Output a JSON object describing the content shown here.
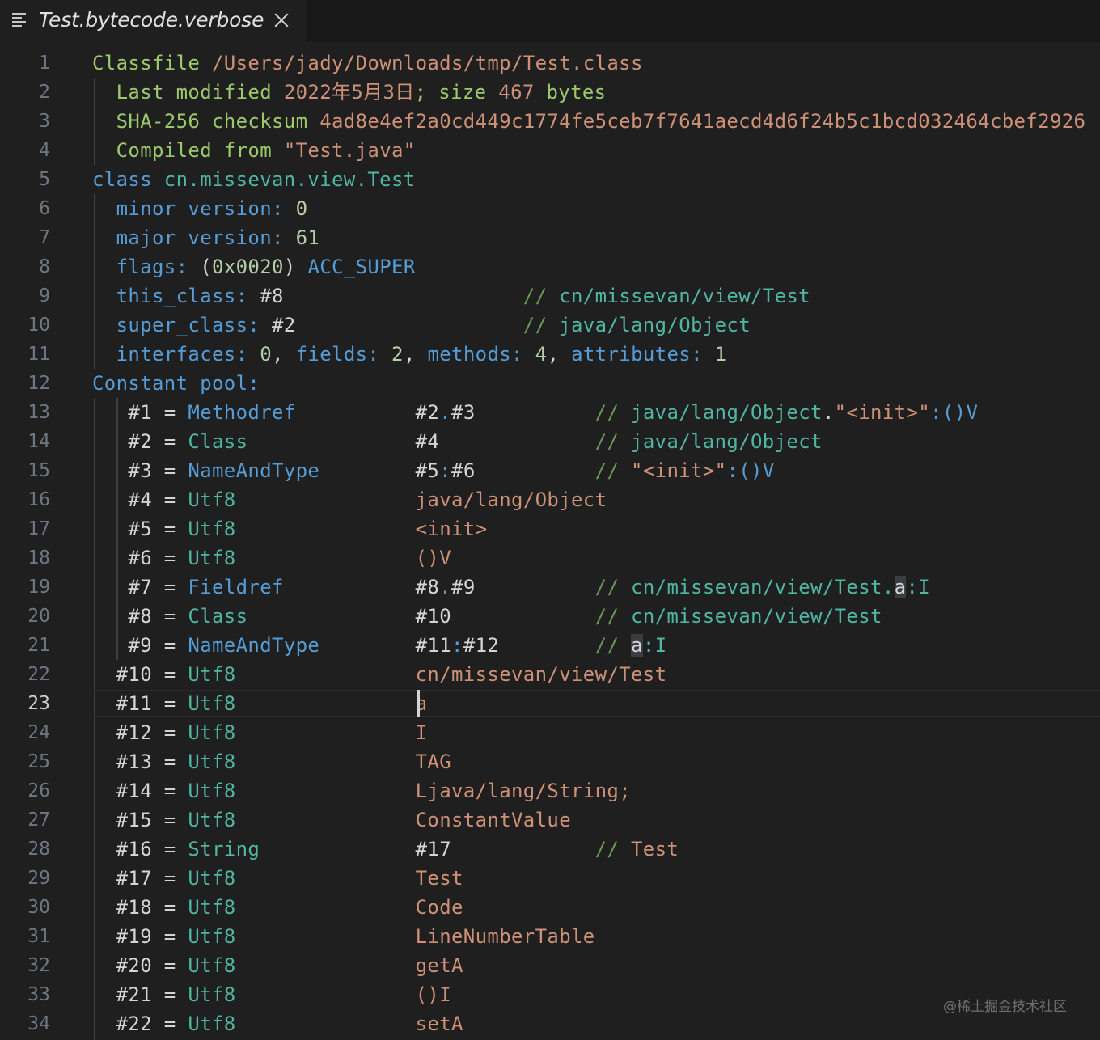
{
  "tab": {
    "title": "Test.bytecode.verbose",
    "close_icon": "close-icon",
    "file_icon": "text-lines-icon"
  },
  "colors": {
    "background": "#1f1f1f",
    "keyword": "#4fb6a2",
    "name": "#569cd6",
    "string": "#ce9178",
    "comment": "#6a9955",
    "number": "#b5cea8"
  },
  "editor": {
    "current_line": 23,
    "lines": [
      {
        "num": "1",
        "tokens": [
          [
            "t-head",
            "Classfile "
          ],
          [
            "t-path",
            "/Users/jady/Downloads/tmp/Test.class"
          ]
        ]
      },
      {
        "num": "2",
        "tokens": [
          [
            "t-plain",
            "  "
          ],
          [
            "t-head",
            "Last modified "
          ],
          [
            "t-str",
            "2022年5月3日"
          ],
          [
            "t-head",
            "; size "
          ],
          [
            "t-str",
            "467"
          ],
          [
            "t-head",
            " bytes"
          ]
        ]
      },
      {
        "num": "3",
        "tokens": [
          [
            "t-plain",
            "  "
          ],
          [
            "t-head",
            "SHA-256 checksum "
          ],
          [
            "t-str",
            "4ad8e4ef2a0cd449c1774fe5ceb7f7641aecd4d6f24b5c1bcd032464cbef2926"
          ]
        ]
      },
      {
        "num": "4",
        "tokens": [
          [
            "t-plain",
            "  "
          ],
          [
            "t-head",
            "Compiled from "
          ],
          [
            "t-str",
            "\"Test.java\""
          ]
        ]
      },
      {
        "num": "5",
        "tokens": [
          [
            "t-key",
            "class "
          ],
          [
            "t-kw",
            "cn.missevan.view.Test"
          ]
        ]
      },
      {
        "num": "6",
        "tokens": [
          [
            "t-plain",
            "  "
          ],
          [
            "t-key",
            "minor version: "
          ],
          [
            "t-num",
            "0"
          ]
        ]
      },
      {
        "num": "7",
        "tokens": [
          [
            "t-plain",
            "  "
          ],
          [
            "t-key",
            "major version: "
          ],
          [
            "t-num",
            "61"
          ]
        ]
      },
      {
        "num": "8",
        "tokens": [
          [
            "t-plain",
            "  "
          ],
          [
            "t-key",
            "flags: "
          ],
          [
            "t-plain",
            "("
          ],
          [
            "t-num",
            "0x0020"
          ],
          [
            "t-plain",
            ") "
          ],
          [
            "t-key",
            "ACC_SUPER"
          ]
        ]
      },
      {
        "num": "9",
        "tokens": [
          [
            "t-plain",
            "  "
          ],
          [
            "t-key",
            "this_class: "
          ],
          [
            "t-plain",
            "#8"
          ],
          [
            "t-plain",
            "                    "
          ],
          [
            "t-cmt",
            "// "
          ],
          [
            "t-kw",
            "cn/missevan/view/Test"
          ]
        ]
      },
      {
        "num": "10",
        "tokens": [
          [
            "t-plain",
            "  "
          ],
          [
            "t-key",
            "super_class: "
          ],
          [
            "t-plain",
            "#2"
          ],
          [
            "t-plain",
            "                   "
          ],
          [
            "t-cmt",
            "// "
          ],
          [
            "t-kw",
            "java/lang/Object"
          ]
        ]
      },
      {
        "num": "11",
        "tokens": [
          [
            "t-plain",
            "  "
          ],
          [
            "t-key",
            "interfaces: "
          ],
          [
            "t-num",
            "0"
          ],
          [
            "t-plain",
            ", "
          ],
          [
            "t-key",
            "fields: "
          ],
          [
            "t-num",
            "2"
          ],
          [
            "t-plain",
            ", "
          ],
          [
            "t-key",
            "methods: "
          ],
          [
            "t-num",
            "4"
          ],
          [
            "t-plain",
            ", "
          ],
          [
            "t-key",
            "attributes: "
          ],
          [
            "t-num",
            "1"
          ]
        ]
      },
      {
        "num": "12",
        "tokens": [
          [
            "t-key",
            "Constant pool:"
          ]
        ]
      },
      {
        "num": "13",
        "tokens": [
          [
            "t-plain",
            "   #1 = "
          ],
          [
            "t-key",
            "Methodref"
          ],
          [
            "t-plain",
            "          "
          ],
          [
            "t-plain",
            "#2"
          ],
          [
            "t-key",
            "."
          ],
          [
            "t-plain",
            "#3"
          ],
          [
            "t-plain",
            "          "
          ],
          [
            "t-cmt",
            "// "
          ],
          [
            "t-kw",
            "java/lang/Object"
          ],
          [
            "t-plain",
            "."
          ],
          [
            "t-str",
            "\"<init>\""
          ],
          [
            "t-key",
            ":()V"
          ]
        ]
      },
      {
        "num": "14",
        "tokens": [
          [
            "t-plain",
            "   #2 = "
          ],
          [
            "t-kw",
            "Class"
          ],
          [
            "t-plain",
            "              "
          ],
          [
            "t-plain",
            "#4"
          ],
          [
            "t-plain",
            "             "
          ],
          [
            "t-cmt",
            "// "
          ],
          [
            "t-kw",
            "java/lang/Object"
          ]
        ]
      },
      {
        "num": "15",
        "tokens": [
          [
            "t-plain",
            "   #3 = "
          ],
          [
            "t-key",
            "NameAndType"
          ],
          [
            "t-plain",
            "        "
          ],
          [
            "t-plain",
            "#5"
          ],
          [
            "t-key",
            ":"
          ],
          [
            "t-plain",
            "#6"
          ],
          [
            "t-plain",
            "          "
          ],
          [
            "t-cmt",
            "// "
          ],
          [
            "t-str",
            "\"<init>\""
          ],
          [
            "t-key",
            ":()V"
          ]
        ]
      },
      {
        "num": "16",
        "tokens": [
          [
            "t-plain",
            "   #4 = "
          ],
          [
            "t-kw",
            "Utf8"
          ],
          [
            "t-plain",
            "               "
          ],
          [
            "t-str",
            "java/lang/Object"
          ]
        ]
      },
      {
        "num": "17",
        "tokens": [
          [
            "t-plain",
            "   #5 = "
          ],
          [
            "t-kw",
            "Utf8"
          ],
          [
            "t-plain",
            "               "
          ],
          [
            "t-str",
            "<init>"
          ]
        ]
      },
      {
        "num": "18",
        "tokens": [
          [
            "t-plain",
            "   #6 = "
          ],
          [
            "t-kw",
            "Utf8"
          ],
          [
            "t-plain",
            "               "
          ],
          [
            "t-str",
            "()V"
          ]
        ]
      },
      {
        "num": "19",
        "tokens": [
          [
            "t-plain",
            "   #7 = "
          ],
          [
            "t-key",
            "Fieldref"
          ],
          [
            "t-plain",
            "           "
          ],
          [
            "t-plain",
            "#8"
          ],
          [
            "t-key",
            "."
          ],
          [
            "t-plain",
            "#9"
          ],
          [
            "t-plain",
            "          "
          ],
          [
            "t-cmt",
            "// "
          ],
          [
            "t-kw",
            "cn/missevan/view/Test."
          ],
          [
            "hl",
            "a"
          ],
          [
            "t-kw",
            ":I"
          ]
        ]
      },
      {
        "num": "20",
        "tokens": [
          [
            "t-plain",
            "   #8 = "
          ],
          [
            "t-kw",
            "Class"
          ],
          [
            "t-plain",
            "              "
          ],
          [
            "t-plain",
            "#10"
          ],
          [
            "t-plain",
            "            "
          ],
          [
            "t-cmt",
            "// "
          ],
          [
            "t-kw",
            "cn/missevan/view/Test"
          ]
        ]
      },
      {
        "num": "21",
        "tokens": [
          [
            "t-plain",
            "   #9 = "
          ],
          [
            "t-key",
            "NameAndType"
          ],
          [
            "t-plain",
            "        "
          ],
          [
            "t-plain",
            "#11"
          ],
          [
            "t-key",
            ":"
          ],
          [
            "t-plain",
            "#12"
          ],
          [
            "t-plain",
            "        "
          ],
          [
            "t-cmt",
            "// "
          ],
          [
            "hl",
            "a"
          ],
          [
            "t-kw",
            ":I"
          ]
        ]
      },
      {
        "num": "22",
        "tokens": [
          [
            "t-plain",
            "  #10 = "
          ],
          [
            "t-kw",
            "Utf8"
          ],
          [
            "t-plain",
            "               "
          ],
          [
            "t-str",
            "cn/missevan/view/Test"
          ]
        ]
      },
      {
        "num": "23",
        "tokens": [
          [
            "t-plain",
            "  #11 = "
          ],
          [
            "t-kw",
            "Utf8"
          ],
          [
            "t-plain",
            "               "
          ],
          [
            "t-str",
            "a"
          ]
        ]
      },
      {
        "num": "24",
        "tokens": [
          [
            "t-plain",
            "  #12 = "
          ],
          [
            "t-kw",
            "Utf8"
          ],
          [
            "t-plain",
            "               "
          ],
          [
            "t-str",
            "I"
          ]
        ]
      },
      {
        "num": "25",
        "tokens": [
          [
            "t-plain",
            "  #13 = "
          ],
          [
            "t-kw",
            "Utf8"
          ],
          [
            "t-plain",
            "               "
          ],
          [
            "t-str",
            "TAG"
          ]
        ]
      },
      {
        "num": "26",
        "tokens": [
          [
            "t-plain",
            "  #14 = "
          ],
          [
            "t-kw",
            "Utf8"
          ],
          [
            "t-plain",
            "               "
          ],
          [
            "t-str",
            "Ljava/lang/String;"
          ]
        ]
      },
      {
        "num": "27",
        "tokens": [
          [
            "t-plain",
            "  #15 = "
          ],
          [
            "t-kw",
            "Utf8"
          ],
          [
            "t-plain",
            "               "
          ],
          [
            "t-str",
            "ConstantValue"
          ]
        ]
      },
      {
        "num": "28",
        "tokens": [
          [
            "t-plain",
            "  #16 = "
          ],
          [
            "t-kw",
            "String"
          ],
          [
            "t-plain",
            "             "
          ],
          [
            "t-plain",
            "#17"
          ],
          [
            "t-plain",
            "            "
          ],
          [
            "t-cmt",
            "// "
          ],
          [
            "t-str",
            "Test"
          ]
        ]
      },
      {
        "num": "29",
        "tokens": [
          [
            "t-plain",
            "  #17 = "
          ],
          [
            "t-kw",
            "Utf8"
          ],
          [
            "t-plain",
            "               "
          ],
          [
            "t-str",
            "Test"
          ]
        ]
      },
      {
        "num": "30",
        "tokens": [
          [
            "t-plain",
            "  #18 = "
          ],
          [
            "t-kw",
            "Utf8"
          ],
          [
            "t-plain",
            "               "
          ],
          [
            "t-str",
            "Code"
          ]
        ]
      },
      {
        "num": "31",
        "tokens": [
          [
            "t-plain",
            "  #19 = "
          ],
          [
            "t-kw",
            "Utf8"
          ],
          [
            "t-plain",
            "               "
          ],
          [
            "t-str",
            "LineNumberTable"
          ]
        ]
      },
      {
        "num": "32",
        "tokens": [
          [
            "t-plain",
            "  #20 = "
          ],
          [
            "t-kw",
            "Utf8"
          ],
          [
            "t-plain",
            "               "
          ],
          [
            "t-str",
            "getA"
          ]
        ]
      },
      {
        "num": "33",
        "tokens": [
          [
            "t-plain",
            "  #21 = "
          ],
          [
            "t-kw",
            "Utf8"
          ],
          [
            "t-plain",
            "               "
          ],
          [
            "t-str",
            "()I"
          ]
        ]
      },
      {
        "num": "34",
        "tokens": [
          [
            "t-plain",
            "  #22 = "
          ],
          [
            "t-kw",
            "Utf8"
          ],
          [
            "t-plain",
            "               "
          ],
          [
            "t-str",
            "setA"
          ]
        ]
      }
    ]
  },
  "watermark": "@稀土掘金技术社区"
}
